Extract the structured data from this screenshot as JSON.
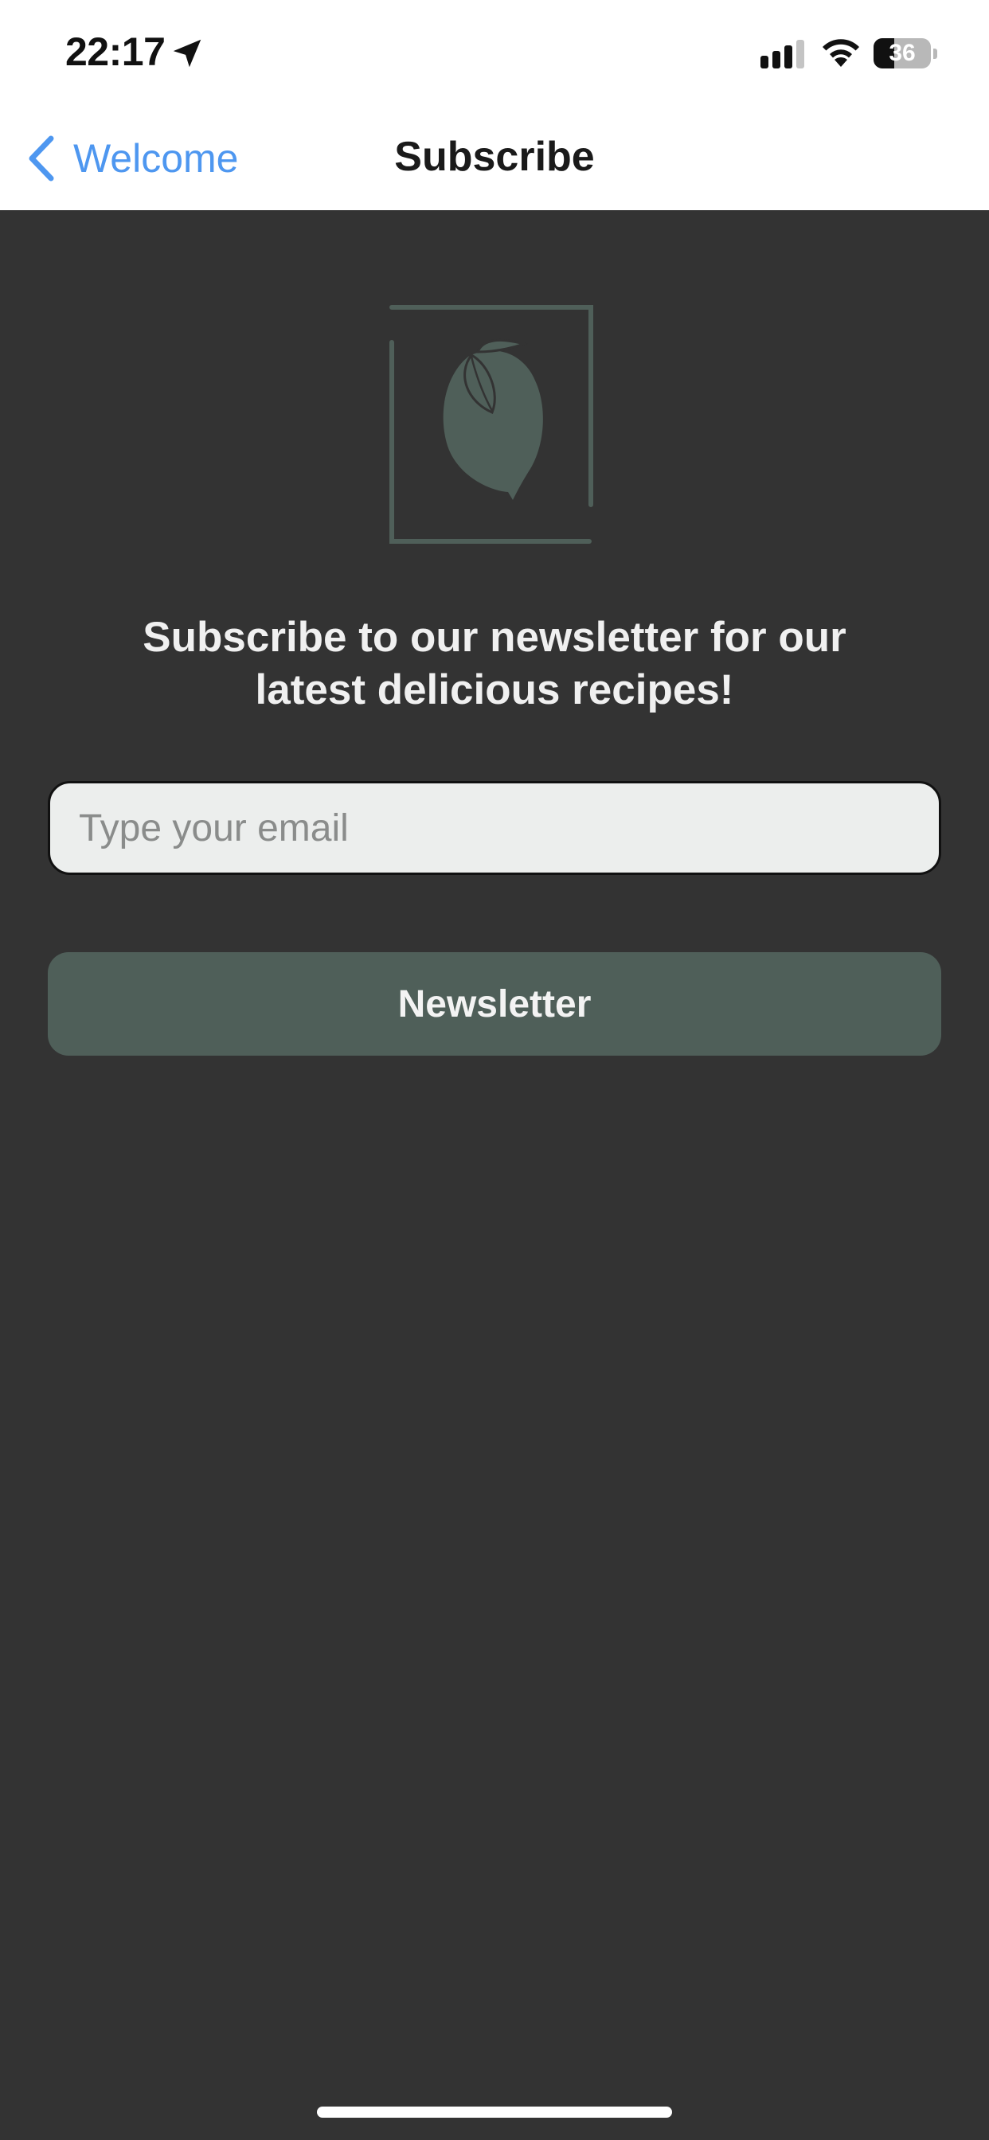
{
  "status_bar": {
    "time": "22:17",
    "battery_level": "36",
    "battery_fraction": 0.36,
    "icons": [
      "location-arrow-icon",
      "cellular-signal-icon",
      "wifi-icon",
      "battery-icon"
    ]
  },
  "nav": {
    "back_label": "Welcome",
    "title": "Subscribe",
    "back_icon": "chevron-left-icon"
  },
  "main": {
    "logo_icon": "lemon-icon",
    "headline": "Subscribe to our newsletter for our latest delicious recipes!",
    "email_placeholder": "Type your email",
    "email_value": "",
    "button_label": "Newsletter"
  },
  "colors": {
    "background": "#333333",
    "accent_green": "#4f5f59",
    "link_blue": "#4e97f0",
    "input_bg": "#eceeed"
  }
}
